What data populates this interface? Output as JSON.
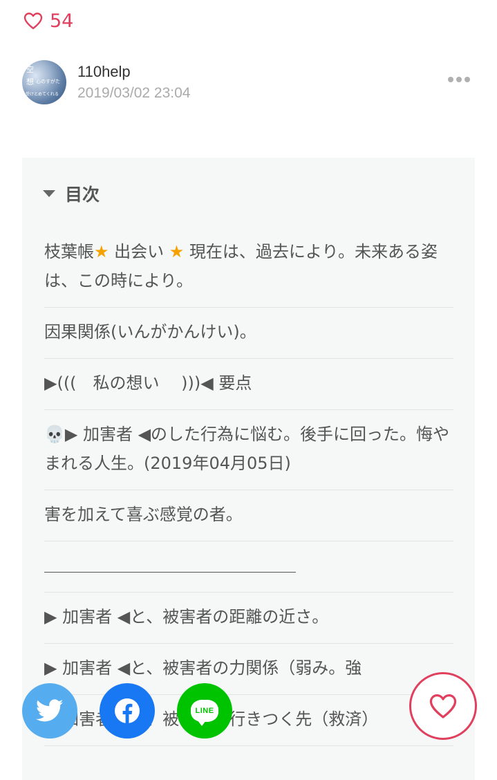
{
  "likes": {
    "count": "54"
  },
  "author": {
    "name": "110help",
    "date": "2019/03/02 23:04",
    "avatar_text": [
      "空",
      "想",
      "心のすがた",
      "受けとめてくれる"
    ]
  },
  "toc": {
    "title": "目次",
    "items": [
      {
        "pre": "枝葉帳",
        "star1": "★",
        "mid": " 出会い ",
        "star2": "★",
        "post": " 現在は、過去により。未来ある姿は、この時により。"
      },
      {
        "text": "因果関係(いんがかんけい)。"
      },
      {
        "text": "▶(((　私の想い　 )))◀ 要点"
      },
      {
        "text": "💀▶ 加害者 ◀のした行為に悩む。後手に回った。悔やまれる人生。(2019年04月05日)"
      },
      {
        "text": "害を加えて喜ぶ感覚の者。"
      },
      {
        "text": ""
      },
      {
        "text": "▶ 加害者 ◀と、被害者の距離の近さ。"
      },
      {
        "text": "▶ 加害者 ◀と、被害者の力関係（弱み。強"
      },
      {
        "text": "▶ 加害者 ◀と、被害者が行きつく先（救済）"
      }
    ]
  },
  "share": {
    "twitter_icon": "twitter-bird-icon",
    "facebook_icon": "facebook-f-icon",
    "line_label": "LINE"
  },
  "colors": {
    "accent": "#e0405e",
    "twitter": "#55acee",
    "facebook": "#1877f2",
    "line": "#00c300",
    "star": "#f5a100"
  }
}
